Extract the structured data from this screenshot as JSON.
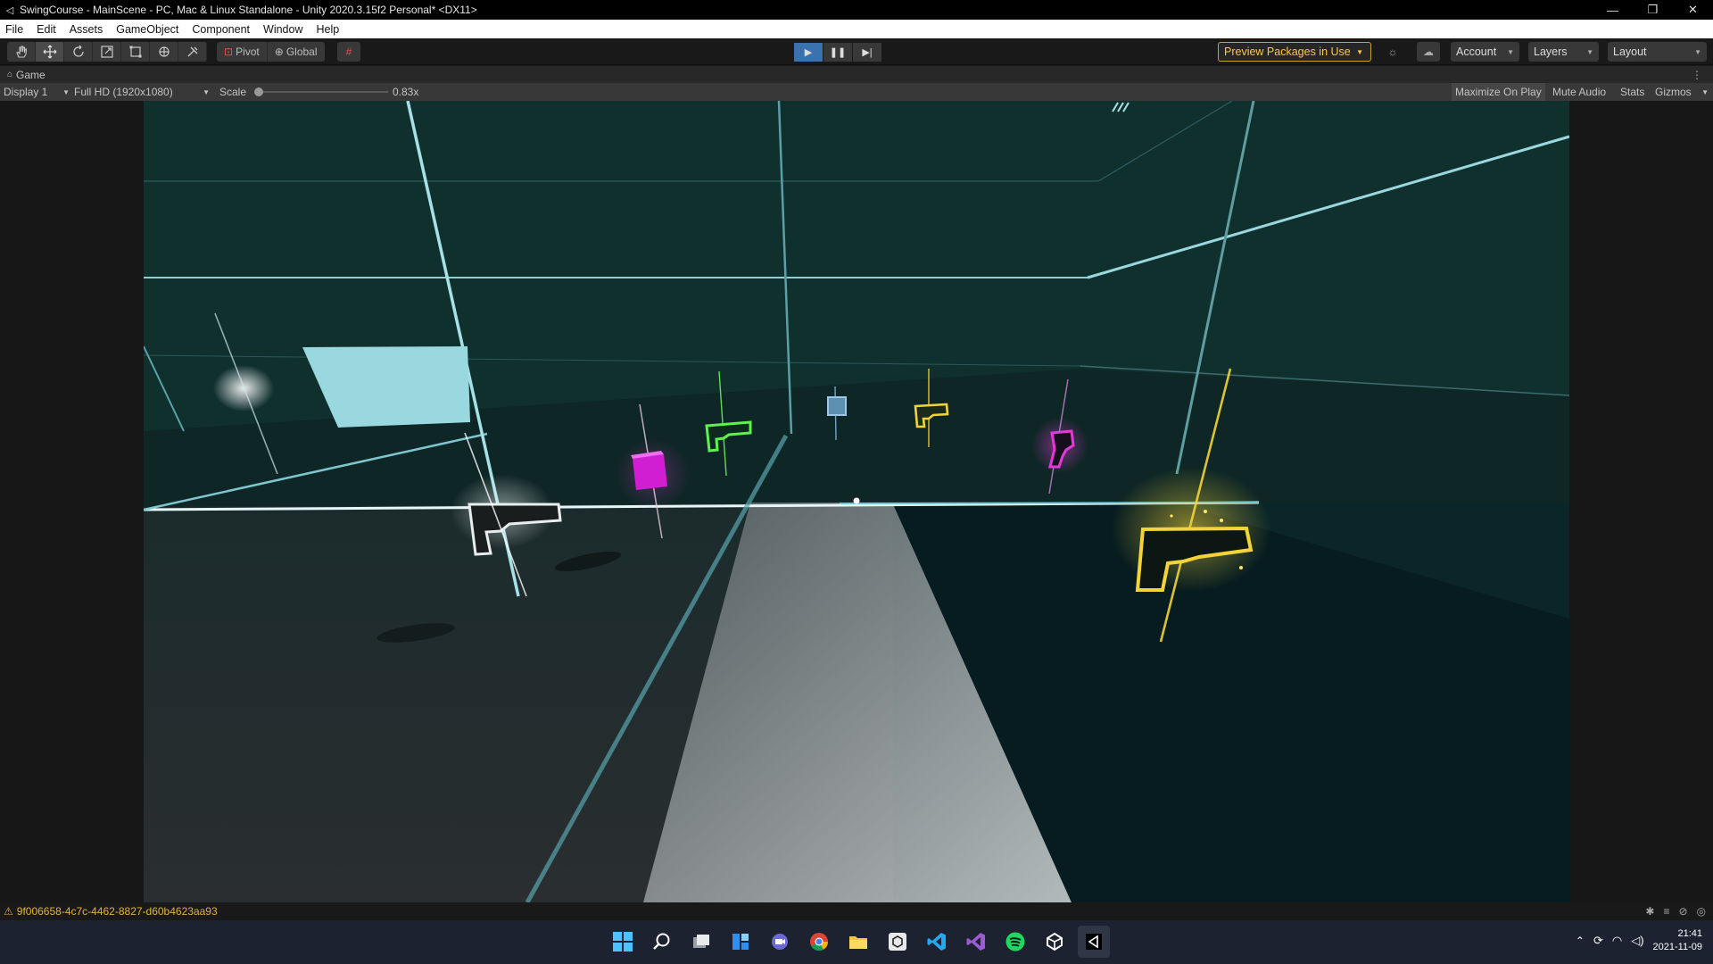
{
  "window": {
    "title": "SwingCourse - MainScene - PC, Mac & Linux Standalone - Unity 2020.3.15f2 Personal* <DX11>",
    "controls": [
      "—",
      "❐",
      "✕"
    ]
  },
  "menu": [
    "File",
    "Edit",
    "Assets",
    "GameObject",
    "Component",
    "Window",
    "Help"
  ],
  "toolbar": {
    "tools": [
      "hand-tool-icon",
      "move-tool-icon",
      "rotate-tool-icon",
      "scale-tool-icon",
      "rect-tool-icon",
      "transform-tool-icon",
      "custom-tool-icon"
    ],
    "pivot_label": "Pivot",
    "global_label": "Global",
    "preview_packages": "Preview Packages in Use",
    "account": "Account",
    "layers": "Layers",
    "layout": "Layout",
    "play_state": "playing"
  },
  "tab": {
    "label": "Game"
  },
  "game_bar": {
    "display": "Display 1",
    "resolution": "Full HD (1920x1080)",
    "scale_label": "Scale",
    "scale_value": "0.83x",
    "maximize": "Maximize On Play",
    "mute": "Mute Audio",
    "stats": "Stats",
    "gizmos": "Gizmos"
  },
  "status": {
    "message": "9f006658-4c7c-4462-8827-d60b4623aa93"
  },
  "taskbar": {
    "apps": [
      "start-icon",
      "search-icon",
      "task-view-icon",
      "widgets-icon",
      "chat-icon",
      "chrome-icon",
      "file-explorer-icon",
      "unity-hub-icon",
      "vscode-icon",
      "visual-studio-icon",
      "spotify-icon",
      "unity-icon",
      "unity-editor-icon"
    ],
    "time": "21:41",
    "date": "2021-11-09"
  },
  "colors": {
    "accent_play": "#3a72b0",
    "warning": "#e5b33a",
    "neon_cyan": "#9ad8e0",
    "neon_green": "#5df24f",
    "neon_yellow": "#f2d43a",
    "neon_magenta": "#e23ad8"
  }
}
